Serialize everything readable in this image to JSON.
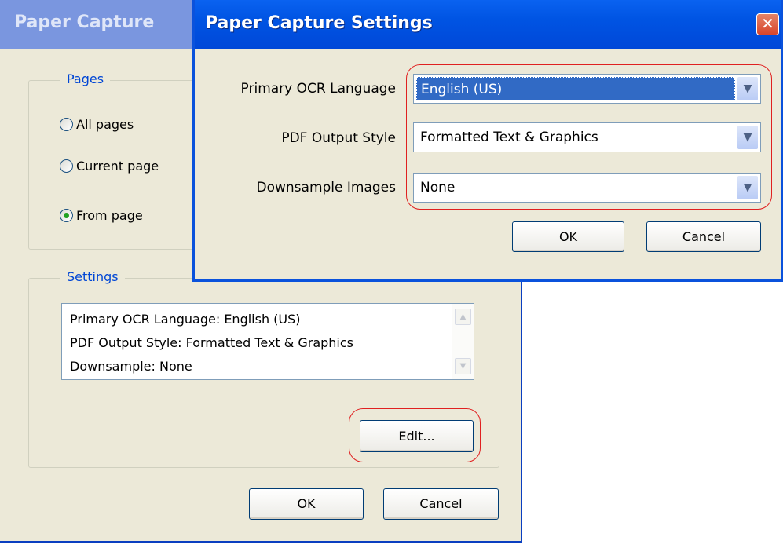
{
  "back_dialog": {
    "title": "Paper Capture",
    "pages_group": {
      "legend": "Pages",
      "options": [
        {
          "label": "All pages",
          "checked": false
        },
        {
          "label": "Current page",
          "checked": false
        },
        {
          "label": "From page",
          "checked": true
        }
      ]
    },
    "settings_group": {
      "legend": "Settings",
      "summary_lines": [
        "Primary OCR Language: English (US)",
        "PDF Output Style: Formatted Text & Graphics",
        "Downsample: None"
      ],
      "edit_label": "Edit..."
    },
    "ok_label": "OK",
    "cancel_label": "Cancel"
  },
  "front_dialog": {
    "title": "Paper Capture Settings",
    "close_glyph": "✕",
    "fields": [
      {
        "label": "Primary OCR Language",
        "value": "English (US)"
      },
      {
        "label": "PDF Output Style",
        "value": "Formatted Text & Graphics"
      },
      {
        "label": "Downsample Images",
        "value": "None"
      }
    ],
    "ok_label": "OK",
    "cancel_label": "Cancel"
  },
  "icons": {
    "dropdown": "chevron-down-icon",
    "scroll_up": "scroll-up-arrow-icon",
    "scroll_down": "scroll-down-arrow-icon"
  },
  "colors": {
    "titlebar_active": "#0054e3",
    "titlebar_inactive": "#7a96df",
    "dialog_face": "#ece9d8",
    "highlight_annotation": "#e02020",
    "selection": "#316ac5"
  }
}
